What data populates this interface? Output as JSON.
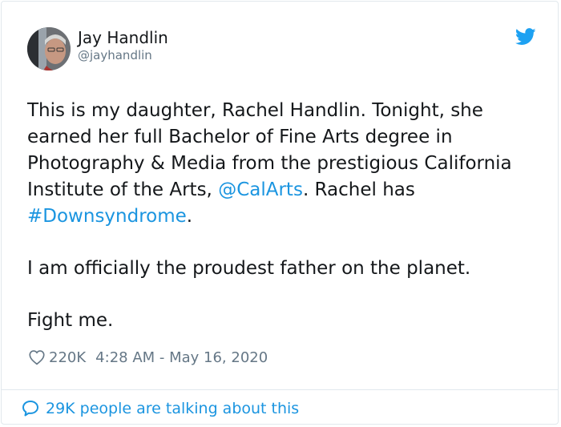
{
  "author": {
    "name": "Jay Handlin",
    "handle": "@jayhandlin"
  },
  "tweet": {
    "text_part1": "This is my daughter, Rachel Handlin. Tonight, she earned her full Bachelor of Fine Arts degree in Photography & Media from the prestigious California Institute of the Arts, ",
    "mention": "@CalArts",
    "text_part2": ". Rachel has ",
    "hashtag": "#Downsyndrome",
    "text_part3": ".",
    "paragraph2": "I am officially the proudest father on the planet.",
    "paragraph3": "Fight me."
  },
  "meta": {
    "likes": "220K",
    "timestamp": "4:28 AM - May 16, 2020"
  },
  "footer": {
    "talking": "29K people are talking about this"
  },
  "colors": {
    "link": "#1b95e0",
    "secondary": "#657786",
    "border": "#e1e8ed",
    "twitter_blue": "#1da1f2"
  },
  "icons": {
    "brand": "twitter-bird-icon",
    "like": "heart-icon",
    "reply": "speech-bubble-icon"
  }
}
